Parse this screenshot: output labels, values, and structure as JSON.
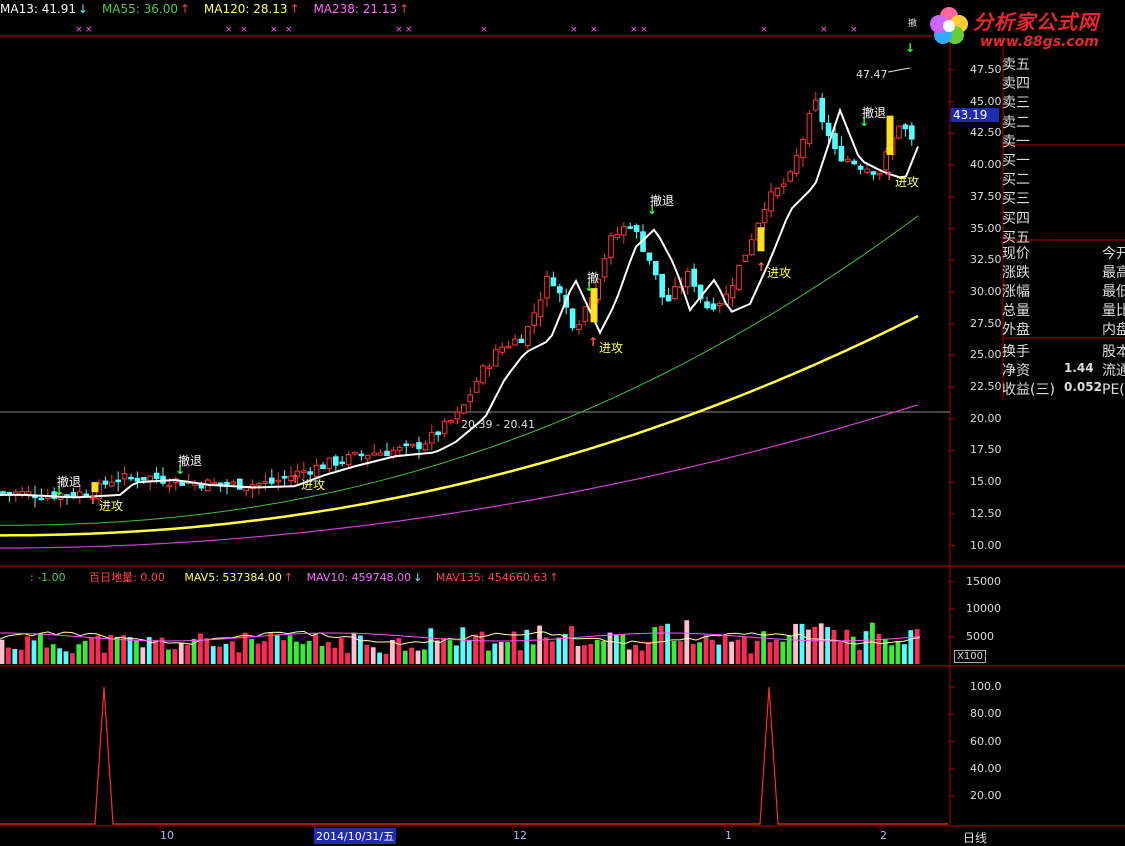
{
  "indicators": {
    "ma13": {
      "label": "MA13: 41.91",
      "arrow": "↓",
      "color": "#ffffff"
    },
    "ma55": {
      "label": "MA55: 36.00",
      "arrow": "↑",
      "color": "#4ec94e"
    },
    "ma120": {
      "label": "MA120: 28.13",
      "arrow": "↑",
      "color": "#ffff66"
    },
    "ma238": {
      "label": "MA238: 21.13",
      "arrow": "↑",
      "color": "#ff66ff"
    }
  },
  "volume_header": {
    "v1": ": -1.00",
    "v2": "百日地量: 0.00",
    "mav5": "MAV5: 537384.00",
    "mav5_arrow": "↑",
    "mav10": "MAV10: 459748.00",
    "mav10_arrow": "↓",
    "mav135": "MAV135: 454660.63",
    "mav135_arrow": "↑"
  },
  "price_axis": [
    "47.50",
    "45.00",
    "42.50",
    "40.00",
    "37.50",
    "35.00",
    "32.50",
    "30.00",
    "27.50",
    "25.00",
    "22.50",
    "20.00",
    "17.50",
    "15.00",
    "12.50",
    "10.00"
  ],
  "volume_axis": [
    "15000",
    "10000",
    "5000"
  ],
  "volume_unit": "X100",
  "osc_axis": [
    "100.0",
    "80.00",
    "60.00",
    "40.00",
    "20.00"
  ],
  "current_price": "43.19",
  "date_axis": {
    "m10": "10",
    "cursor": "2014/10/31/五",
    "m12": "12",
    "m1": "1",
    "m2": "2"
  },
  "period_button": "日线",
  "annotations": {
    "high": "47.47",
    "range": "20.39 - 20.41",
    "retreat": "撤退",
    "attack": "进攻",
    "retreat_cut": "撤",
    "top_tag": "撤"
  },
  "order_book": [
    "卖五",
    "卖四",
    "卖三",
    "卖二",
    "卖一",
    "买一",
    "买二",
    "买三",
    "买四",
    "买五"
  ],
  "quote_fields": [
    {
      "label": "现价",
      "right": "今开"
    },
    {
      "label": "涨跌",
      "right": "最高"
    },
    {
      "label": "涨幅",
      "right": "最低"
    },
    {
      "label": "总量",
      "right": "量比"
    },
    {
      "label": "外盘",
      "right": "内盘"
    }
  ],
  "quote_fields2": [
    {
      "label": "换手",
      "value": "",
      "right": "股本"
    },
    {
      "label": "净资",
      "value": "1.44",
      "right": "流通"
    },
    {
      "label": "收益(三)",
      "value": "0.052",
      "right": "PE(动)"
    }
  ],
  "logo": {
    "name": "分析家公式网",
    "url": "www.88gs.com"
  },
  "colors": {
    "up": "#ff3333",
    "down": "#54ffff",
    "ma13": "#ffffff",
    "ma55": "#3fbf3f",
    "ma120": "#ffff44",
    "ma238": "#d040d0",
    "axis": "#b00000"
  }
}
